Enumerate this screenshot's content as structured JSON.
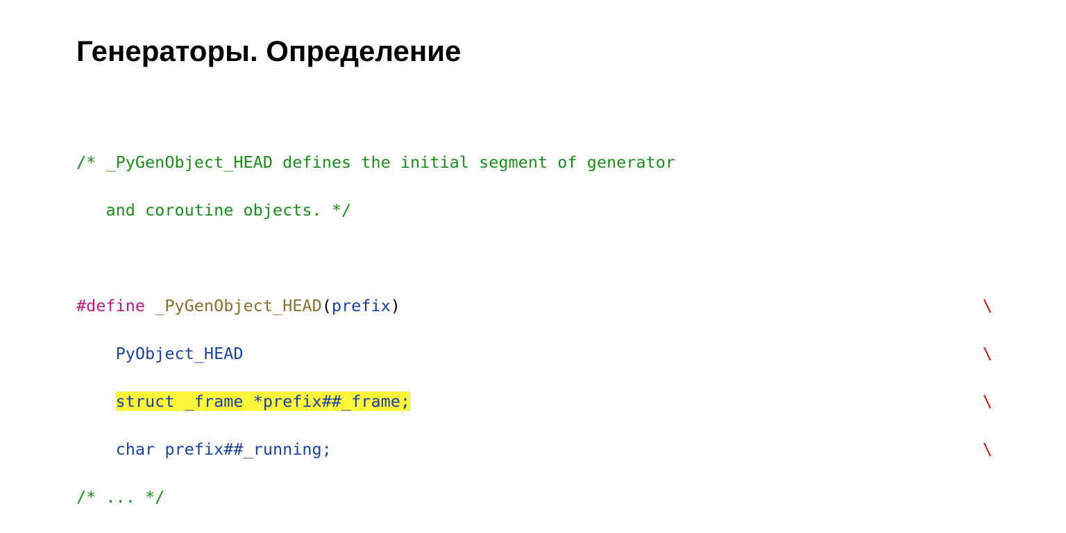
{
  "title": "Генераторы. Определение",
  "code": {
    "comment_line1": "/* _PyGenObject_HEAD defines the initial segment of generator",
    "comment_line2": "   and coroutine objects. */",
    "define_directive": "#define",
    "define_macro": " _PyGenObject_HEAD",
    "define_paren_open": "(",
    "define_param": "prefix",
    "define_paren_close": ")",
    "line_pyobject": "    PyObject_HEAD",
    "line_struct_indent": "    ",
    "line_struct_kw": "struct",
    "line_struct_text": " _frame *prefix##_frame;",
    "line_char_indent": "    ",
    "line_char_kw": "char",
    "line_char_text": " prefix##_running;",
    "comment_end": "/* ... */",
    "backslash": "\\"
  }
}
